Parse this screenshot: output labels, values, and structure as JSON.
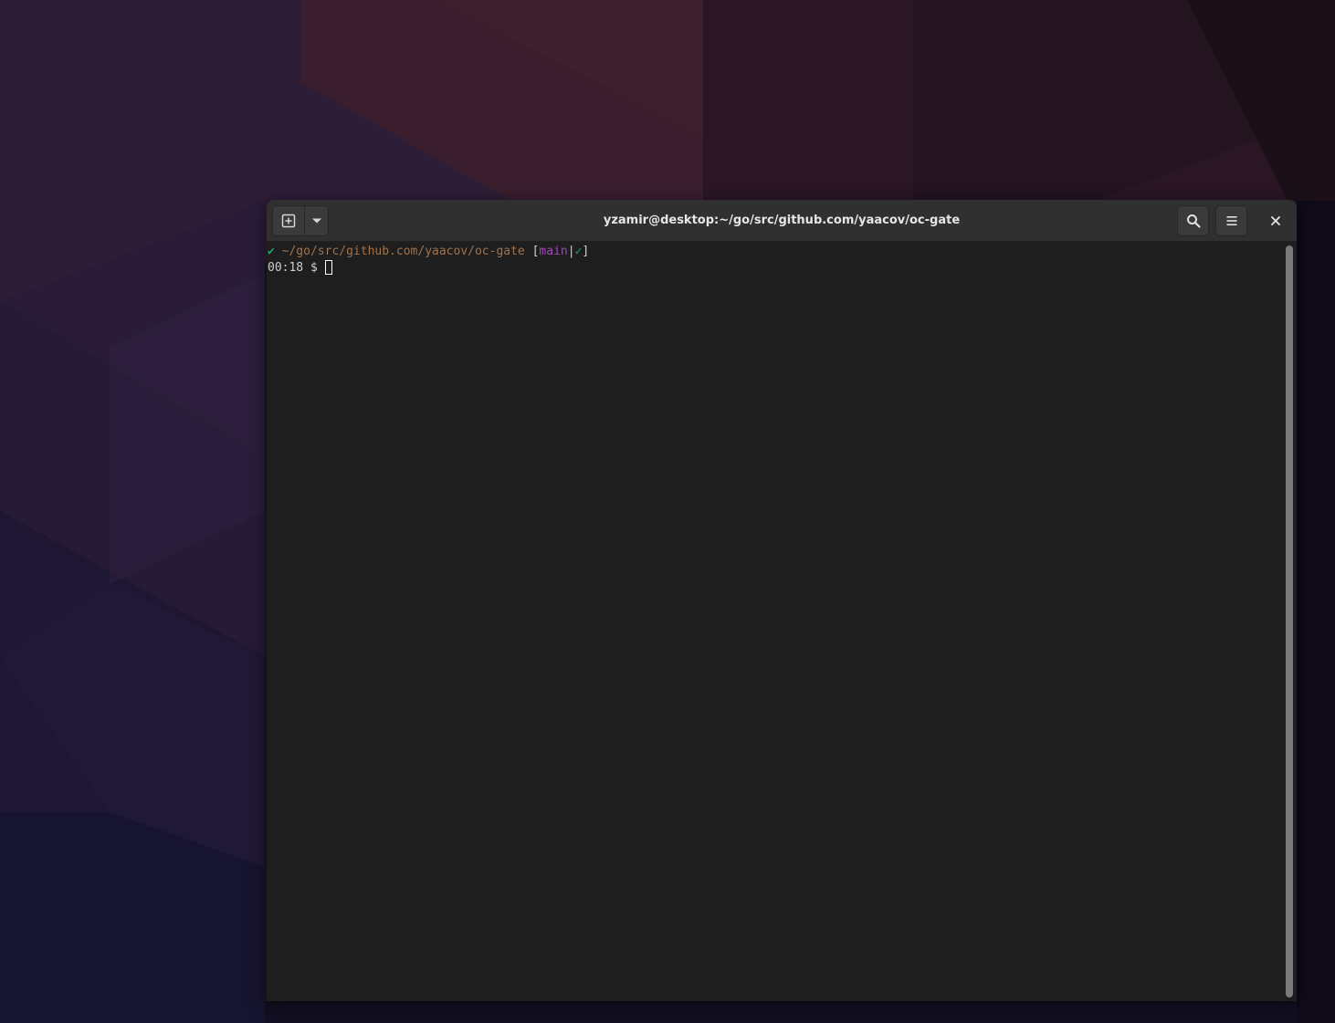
{
  "desktop": {
    "wallpaper_colors": [
      "#2a1a35",
      "#3a1c2c",
      "#241f3c",
      "#1a1428",
      "#100c1a"
    ]
  },
  "window": {
    "title": "yzamir@desktop:~/go/src/github.com/yaacov/oc-gate",
    "buttons": {
      "new_tab_icon": "new-tab-icon",
      "new_tab_menu_icon": "chevron-down-icon",
      "search_icon": "search-icon",
      "menu_icon": "hamburger-icon",
      "close_icon": "close-icon"
    }
  },
  "terminal": {
    "prompt_line": {
      "status_mark": "✔",
      "path": "~/go/src/github.com/yaacov/oc-gate",
      "bracket_open": "[",
      "branch": "main",
      "separator": "|",
      "git_status": "✓",
      "bracket_close": "]"
    },
    "input_line": {
      "time": "00:18",
      "prompt_symbol": "$"
    },
    "colors": {
      "background": "#1e1e1e",
      "foreground": "#d0cfcc",
      "green": "#26a269",
      "orange": "#a2734c",
      "purple": "#a347ba"
    }
  }
}
